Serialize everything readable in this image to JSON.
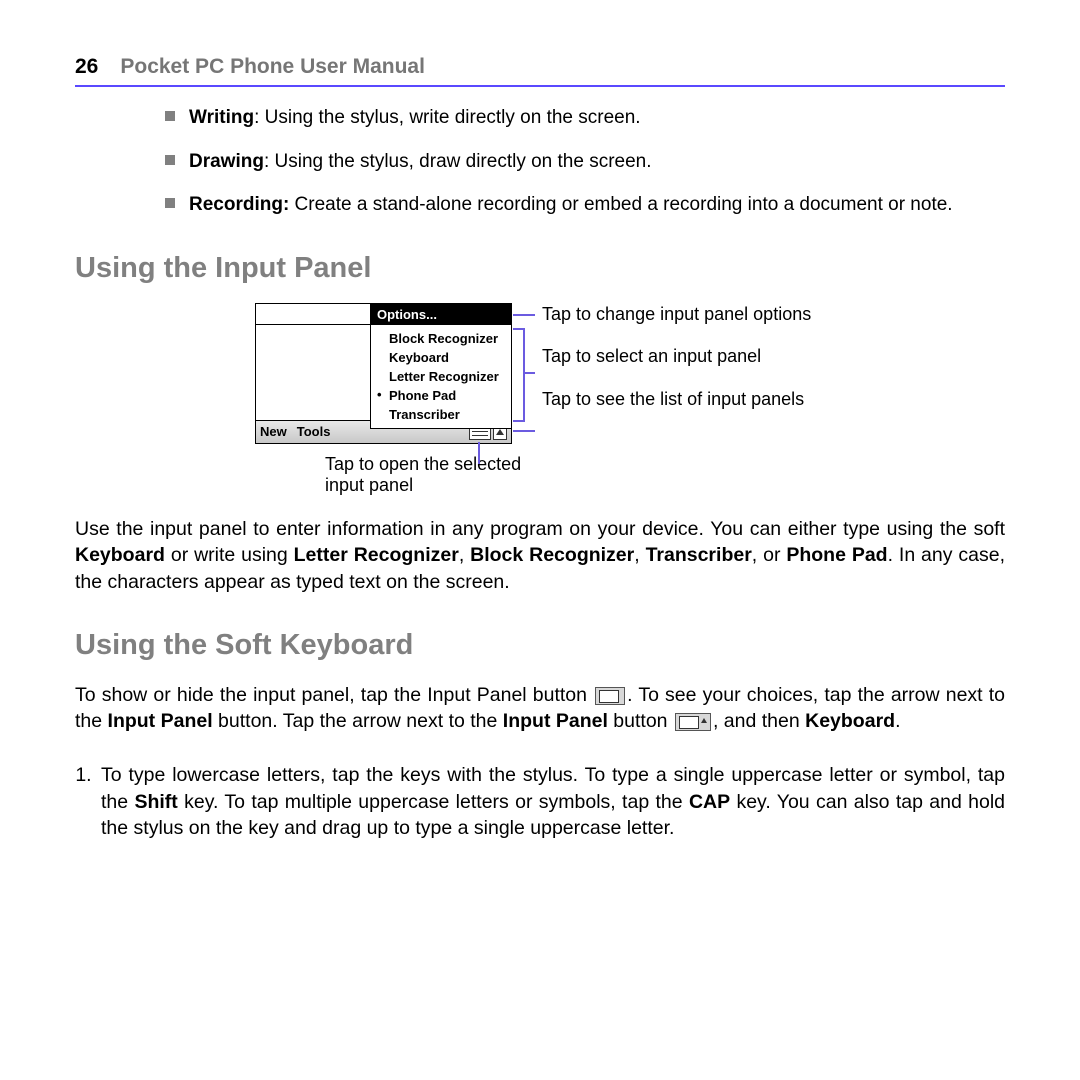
{
  "header": {
    "page_number": "26",
    "title": "Pocket PC Phone User Manual"
  },
  "bullets": [
    {
      "label": "Writing",
      "text": ": Using the stylus, write directly on the screen."
    },
    {
      "label": "Drawing",
      "text": ": Using the stylus, draw directly on the screen."
    },
    {
      "label": "Recording:",
      "text": " Create a stand-alone recording or embed a recording into a document or note."
    }
  ],
  "section1_title": "Using the Input Panel",
  "diagram": {
    "menu_header": "Options...",
    "menu_items": [
      "Block Recognizer",
      "Keyboard",
      "Letter Recognizer",
      "Phone Pad",
      "Transcriber"
    ],
    "selected_index": 3,
    "bar_left": [
      "New",
      "Tools"
    ],
    "callout1": "Tap to change input panel options",
    "callout2": "Tap to select an input panel",
    "callout3": "Tap to see the list of input panels",
    "callout4": "Tap to open the selected input panel"
  },
  "para1_parts": {
    "a": "Use the input panel to enter information in any program on your device. You can either type using the soft ",
    "b": "Keyboard",
    "c": " or write using ",
    "d": "Letter Recognizer",
    "e": ", ",
    "f": "Block Recognizer",
    "g": ", ",
    "h": "Transcriber",
    "i": ", or ",
    "j": "Phone Pad",
    "k": ". In any case, the characters appear as typed text on the screen."
  },
  "section2_title": "Using the Soft Keyboard",
  "para2_parts": {
    "a": "To show or hide the input panel, tap the Input Panel button ",
    "b": ".  To see your choices, tap the arrow next to the ",
    "c": "Input Panel",
    "d": " button.  Tap the arrow next to the ",
    "e": "Input Panel",
    "f": " button ",
    "g": ", and then ",
    "h": "Keyboard",
    "i": "."
  },
  "list_item_parts": {
    "a": "To type lowercase letters, tap the keys with the stylus. To type a single uppercase letter or symbol, tap the ",
    "b": "Shift",
    "c": " key. To tap multiple uppercase letters or symbols, tap the ",
    "d": "CAP",
    "e": " key. You can also tap and hold the stylus on the key and drag up to type a single uppercase letter."
  }
}
